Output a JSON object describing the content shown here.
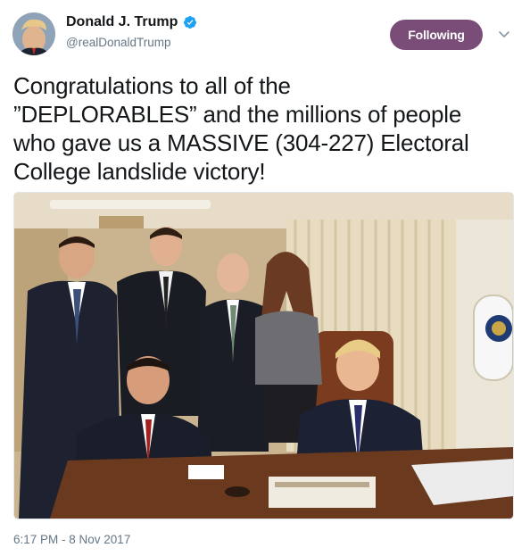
{
  "author": {
    "name": "Donald J. Trump",
    "handle": "@realDonaldTrump",
    "verified": true,
    "avatar_icon": "profile-photo"
  },
  "follow_button": {
    "label": "Following",
    "color": "#794d78"
  },
  "menu_icon": "chevron-down-icon",
  "tweet": {
    "lines": [
      "Congratulations to all of the",
      "”DEPLORABLES” and the millions of people",
      "who gave us a MASSIVE (304-227) Electoral",
      "College landslide victory!"
    ],
    "timestamp": "6:17 PM - 8 Nov 2017"
  },
  "colors": {
    "text": "#14171a",
    "secondary": "#657786",
    "verified": "#1da1f2"
  }
}
